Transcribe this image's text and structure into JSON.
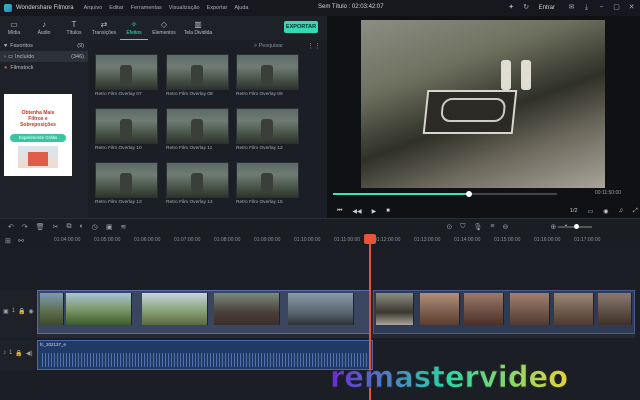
{
  "app": {
    "name": "Wondershare Filmora",
    "doc_title": "Sem Título : 02:03:42:07"
  },
  "menu": [
    "Arquivo",
    "Editar",
    "Ferramentas",
    "Visualização",
    "Exportar",
    "Ajuda"
  ],
  "titlebar": {
    "enter_label": "Entrar"
  },
  "toolbar": {
    "tools": [
      {
        "label": "Mídia",
        "icon": "folder-icon"
      },
      {
        "label": "Áudio",
        "icon": "music-icon"
      },
      {
        "label": "Títulos",
        "icon": "text-icon"
      },
      {
        "label": "Transições",
        "icon": "transition-icon"
      },
      {
        "label": "Efeitos",
        "icon": "effects-icon"
      },
      {
        "label": "Elementos",
        "icon": "elements-icon"
      },
      {
        "label": "Tela Dividida",
        "icon": "split-screen-icon"
      }
    ],
    "active": "Efeitos",
    "export_label": "EXPORTAR"
  },
  "sidebar": {
    "items": [
      {
        "label": "Favoritos",
        "count": "(9)"
      },
      {
        "label": "Incluído",
        "count": "(346)"
      },
      {
        "label": "Filmstock",
        "count": ""
      }
    ],
    "ad": {
      "line1": "Obtenha Mais",
      "line2": "Filtros e",
      "line3": "Sobreposições",
      "button": "Experimente Grátis"
    }
  },
  "search": {
    "placeholder": "Pesquisar"
  },
  "effects": [
    "Retro Film Overlay 07",
    "Retro Film Overlay 08",
    "Retro Film Overlay 09",
    "Retro Film Overlay 10",
    "Retro Film Overlay 11",
    "Retro Film Overlay 12",
    "Retro Film Overlay 13",
    "Retro Film Overlay 14",
    "Retro Film Overlay 15"
  ],
  "preview": {
    "time": "00:11:50:00",
    "page": "1/2",
    "progress": 0.6
  },
  "timeline": {
    "ticks": [
      "01:04:00:00",
      "01:05:00:00",
      "01:06:00:00",
      "01:07:00:00",
      "01:08:00:00",
      "01:09:00:00",
      "01:10:00:00",
      "01:11:00:00",
      "01:12:00:00",
      "01:13:00:00",
      "01:14:00:00",
      "01:15:00:00",
      "01:16:00:00",
      "01:17:00:00"
    ],
    "audio_clip_label": "fc_202137_e",
    "video_track_num": "1",
    "audio_track_num": "1"
  },
  "watermark": "remastervideo",
  "colors": {
    "accent": "#36d9b6",
    "playhead": "#e6553a",
    "video_clip": "#3a4560",
    "audio_clip": "#1f3a66"
  }
}
